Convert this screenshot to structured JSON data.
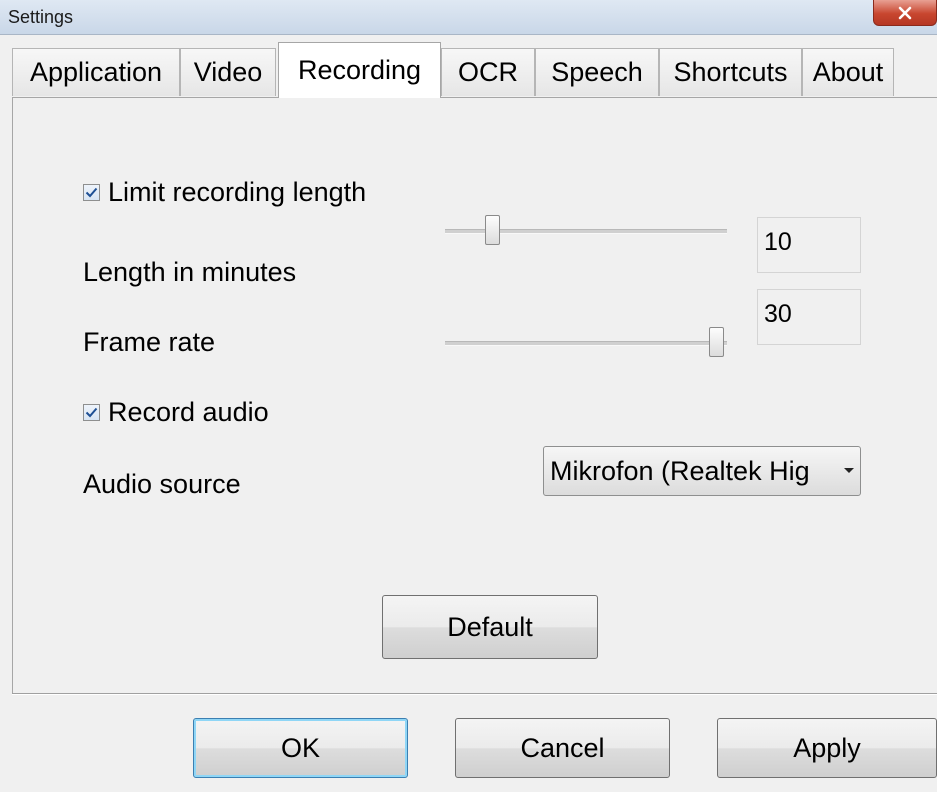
{
  "window": {
    "title": "Settings",
    "close_icon": "close-icon"
  },
  "tabs": [
    {
      "label": "Application",
      "active": false
    },
    {
      "label": "Video",
      "active": false
    },
    {
      "label": "Recording",
      "active": true
    },
    {
      "label": "OCR",
      "active": false
    },
    {
      "label": "Speech",
      "active": false
    },
    {
      "label": "Shortcuts",
      "active": false
    },
    {
      "label": "About",
      "active": false
    }
  ],
  "recording": {
    "limit_length": {
      "label": "Limit recording length",
      "checked": true
    },
    "length_minutes": {
      "label": "Length in minutes",
      "value": "10"
    },
    "frame_rate": {
      "label": "Frame rate",
      "value": "30"
    },
    "record_audio": {
      "label": "Record audio",
      "checked": true
    },
    "audio_source": {
      "label": "Audio source",
      "selected": "Mikrofon (Realtek Hig"
    },
    "default_label": "Default"
  },
  "footer": {
    "ok_label": "OK",
    "cancel_label": "Cancel",
    "apply_label": "Apply"
  }
}
